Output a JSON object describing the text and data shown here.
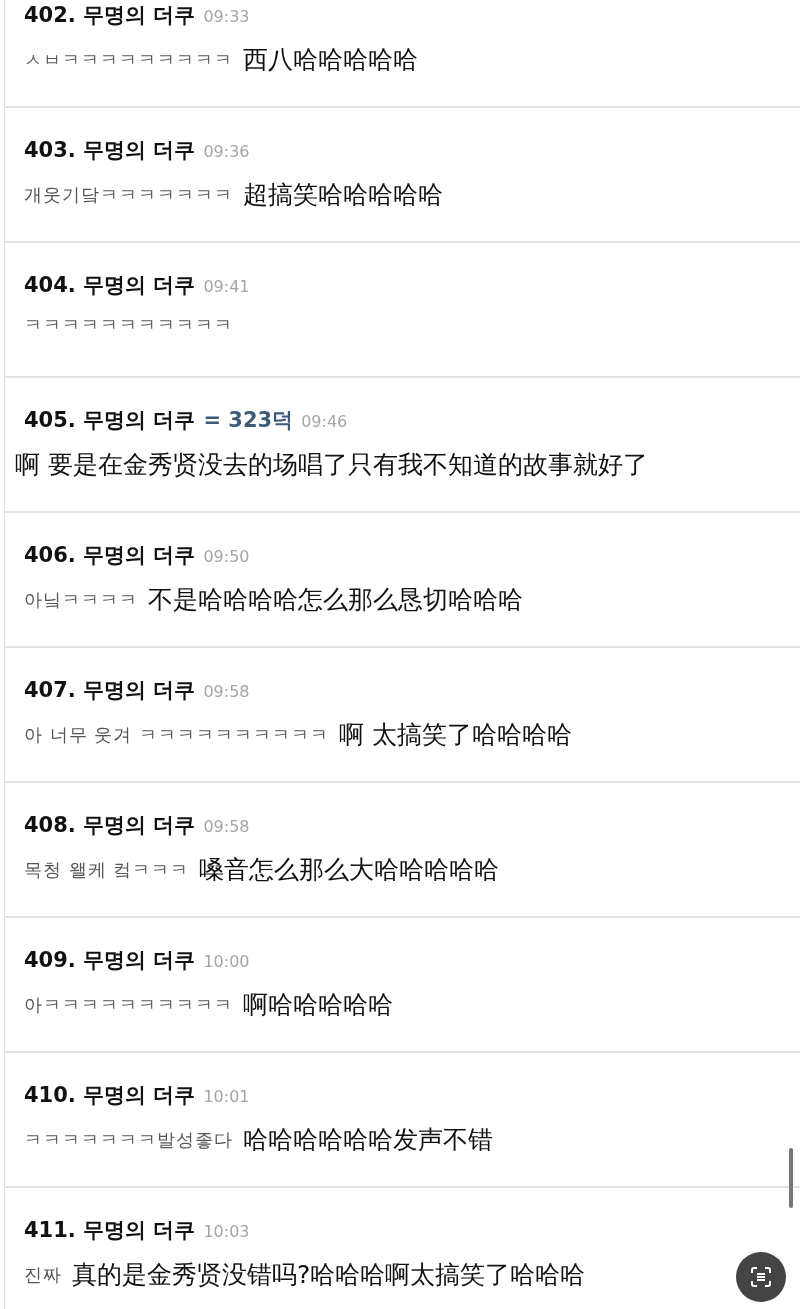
{
  "comments": [
    {
      "number": "402.",
      "author": "무명의 더쿠",
      "time": "09:33",
      "original": "ㅅㅂㅋㅋㅋㅋㅋㅋㅋㅋㅋ",
      "translation": "西八哈哈哈哈哈"
    },
    {
      "number": "403.",
      "author": "무명의 더쿠",
      "time": "09:36",
      "original": "개웃기닼ㅋㅋㅋㅋㅋㅋㅋ",
      "translation": "超搞笑哈哈哈哈哈"
    },
    {
      "number": "404.",
      "author": "무명의 더쿠",
      "time": "09:41",
      "original": "ㅋㅋㅋㅋㅋㅋㅋㅋㅋㅋㅋ"
    },
    {
      "number": "405.",
      "author": "무명의 더쿠",
      "reply_to": "= 323덕",
      "time": "09:46",
      "translation": "啊 要是在金秀贤没去的场唱了只有我不知道的故事就好了"
    },
    {
      "number": "406.",
      "author": "무명의 더쿠",
      "time": "09:50",
      "original": "아닠ㅋㅋㅋㅋ",
      "translation": "不是哈哈哈哈怎么那么恳切哈哈哈"
    },
    {
      "number": "407.",
      "author": "무명의 더쿠",
      "time": "09:58",
      "original": "아 너무 웃겨 ㅋㅋㅋㅋㅋㅋㅋㅋㅋㅋ",
      "translation": "啊 太搞笑了哈哈哈哈"
    },
    {
      "number": "408.",
      "author": "무명의 더쿠",
      "time": "09:58",
      "original": "목청 왤케 컼ㅋㅋㅋ",
      "translation": "嗓音怎么那么大哈哈哈哈哈"
    },
    {
      "number": "409.",
      "author": "무명의 더쿠",
      "time": "10:00",
      "original": "아ㅋㅋㅋㅋㅋㅋㅋㅋㅋㅋ",
      "translation": "啊哈哈哈哈哈"
    },
    {
      "number": "410.",
      "author": "무명의 더쿠",
      "time": "10:01",
      "original": "ㅋㅋㅋㅋㅋㅋㅋ발성좋다",
      "translation": "哈哈哈哈哈哈发声不错"
    },
    {
      "number": "411.",
      "author": "무명의 더쿠",
      "time": "10:03",
      "original": "진짜",
      "translation": "真的是金秀贤没错吗?哈哈哈啊太搞笑了哈哈哈"
    }
  ]
}
